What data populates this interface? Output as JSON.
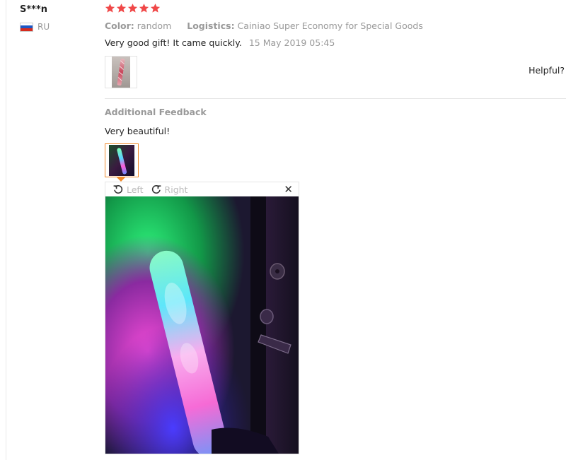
{
  "reviewer": {
    "name": "S***n",
    "country_code": "RU",
    "flag_colors": [
      "#ffffff",
      "#1c57c4",
      "#d52b1e"
    ]
  },
  "review": {
    "stars_filled": 5,
    "stars_total": 5,
    "star_color": "#f04848",
    "color_label": "Color:",
    "color_value": "random",
    "logistics_label": "Logistics:",
    "logistics_value": "Cainiao Super Economy for Special Goods",
    "text": "Very good gift! It came quickly.",
    "date": "15 May 2019 05:45",
    "photo_thumb_icon": "glow-stick-photo",
    "helpful_label": "Helpful?"
  },
  "additional_feedback": {
    "title": "Additional Feedback",
    "text": "Very beautiful!",
    "photo_thumb_icon": "glow-stick-photo",
    "accent_color": "#f08a2b"
  },
  "image_viewer": {
    "rotate_left_label": "Left",
    "rotate_right_label": "Right",
    "close_glyph": "✕",
    "photo_icon": "glow-stick-photo-large"
  }
}
